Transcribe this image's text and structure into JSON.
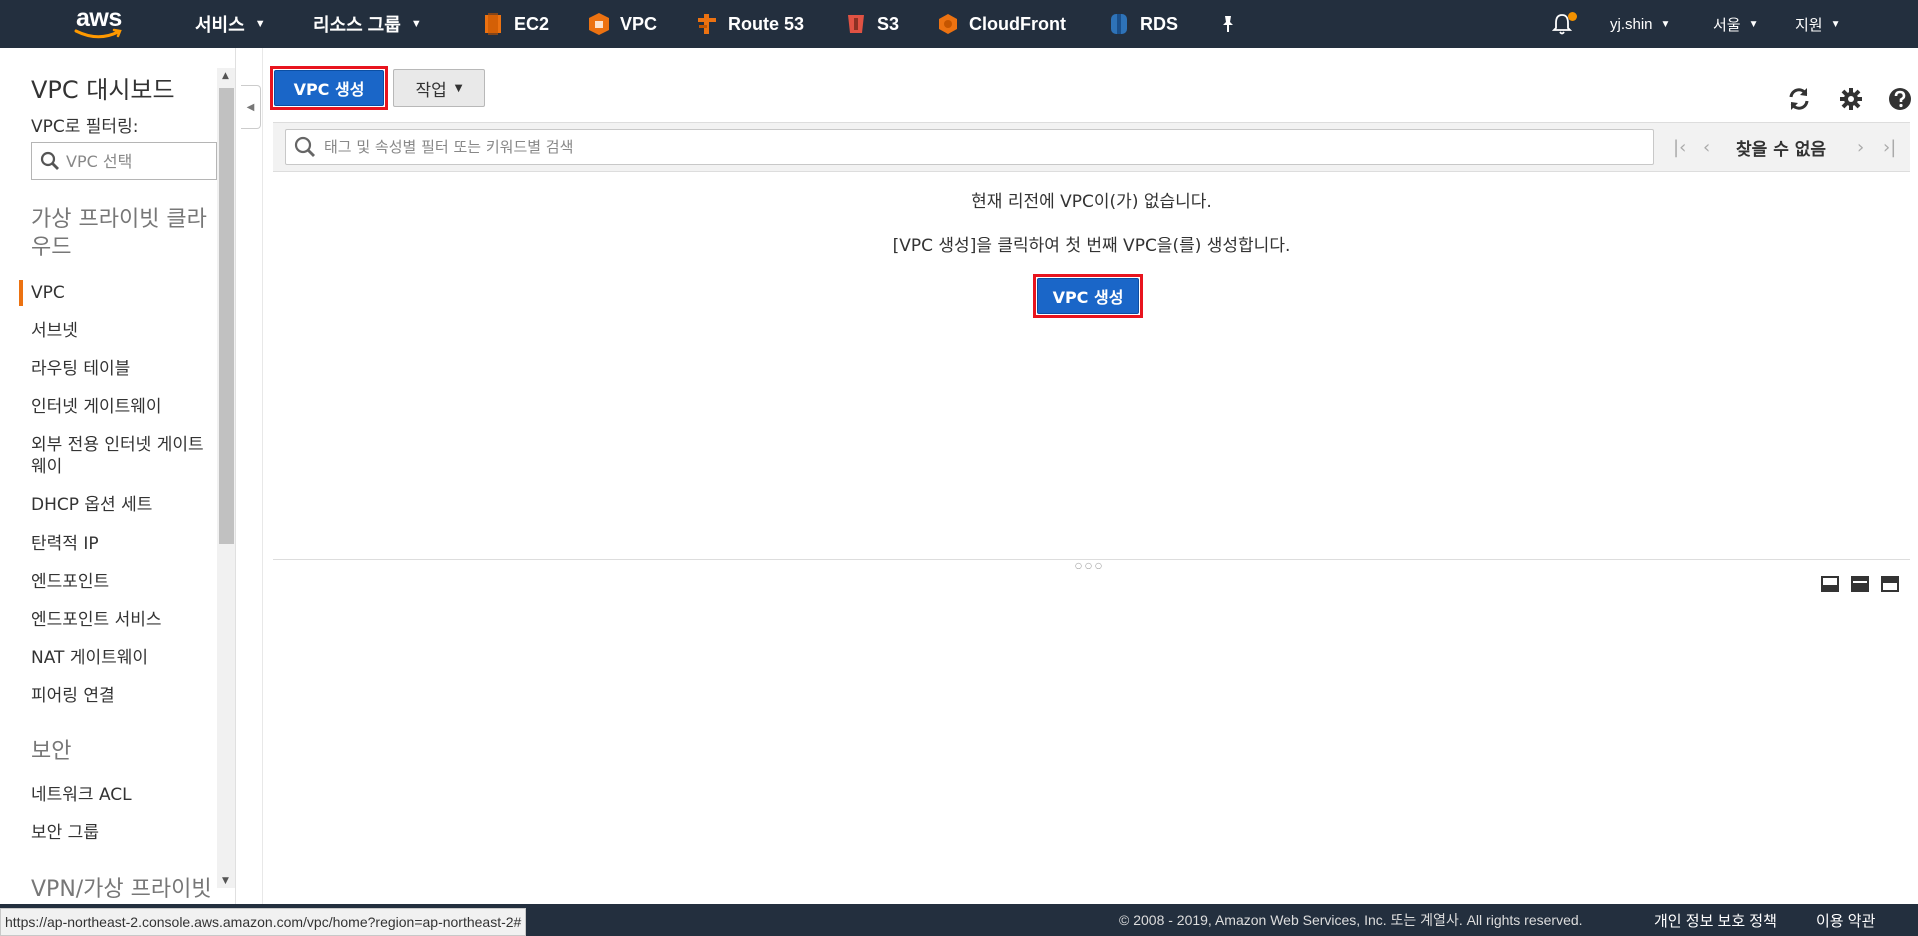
{
  "nav": {
    "logo": "aws",
    "services": "서비스",
    "resource_groups": "리소스 그룹",
    "shortcuts": [
      {
        "label": "EC2",
        "icon": "ec2-icon",
        "color": "#ec7211"
      },
      {
        "label": "VPC",
        "icon": "vpc-icon",
        "color": "#ec7211"
      },
      {
        "label": "Route 53",
        "icon": "route53-icon",
        "color": "#ec7211"
      },
      {
        "label": "S3",
        "icon": "s3-icon",
        "color": "#e05243"
      },
      {
        "label": "CloudFront",
        "icon": "cloudfront-icon",
        "color": "#ec7211"
      },
      {
        "label": "RDS",
        "icon": "rds-icon",
        "color": "#2e73b8"
      }
    ],
    "user": "yj.shin",
    "region": "서울",
    "support": "지원"
  },
  "sidebar": {
    "title": "VPC 대시보드",
    "filter_label": "VPC로 필터링:",
    "filter_placeholder": "VPC 선택",
    "section_vpc": "가상 프라이빗 클라우드",
    "items_vpc": [
      {
        "label": "VPC"
      },
      {
        "label": "서브넷"
      },
      {
        "label": "라우팅 테이블"
      },
      {
        "label": "인터넷 게이트웨이"
      },
      {
        "label": "외부 전용 인터넷 게이트웨이"
      },
      {
        "label": "DHCP 옵션 세트"
      },
      {
        "label": "탄력적 IP"
      },
      {
        "label": "엔드포인트"
      },
      {
        "label": "엔드포인트 서비스"
      },
      {
        "label": "NAT 게이트웨이"
      },
      {
        "label": "피어링 연결"
      }
    ],
    "section_security": "보안",
    "items_security": [
      {
        "label": "네트워크 ACL"
      },
      {
        "label": "보안 그룹"
      }
    ],
    "section_vpn": "VPN/가상 프라이빗"
  },
  "main": {
    "create_button": "VPC 생성",
    "actions_button": "작업",
    "filter_placeholder": "태그 및 속성별 필터 또는 키워드별 검색",
    "pager_text": "찾을 수 없음",
    "empty_title": "현재 리전에 VPC이(가) 없습니다.",
    "empty_hint": "[VPC 생성]을 클릭하여 첫 번째 VPC을(를) 생성합니다.",
    "empty_button": "VPC 생성"
  },
  "footer": {
    "copyright": "© 2008 - 2019, Amazon Web Services, Inc. 또는 계열사. All rights reserved.",
    "privacy": "개인 정보 보호 정책",
    "terms": "이용 약관"
  },
  "status_url": "https://ap-northeast-2.console.aws.amazon.com/vpc/home?region=ap-northeast-2#"
}
